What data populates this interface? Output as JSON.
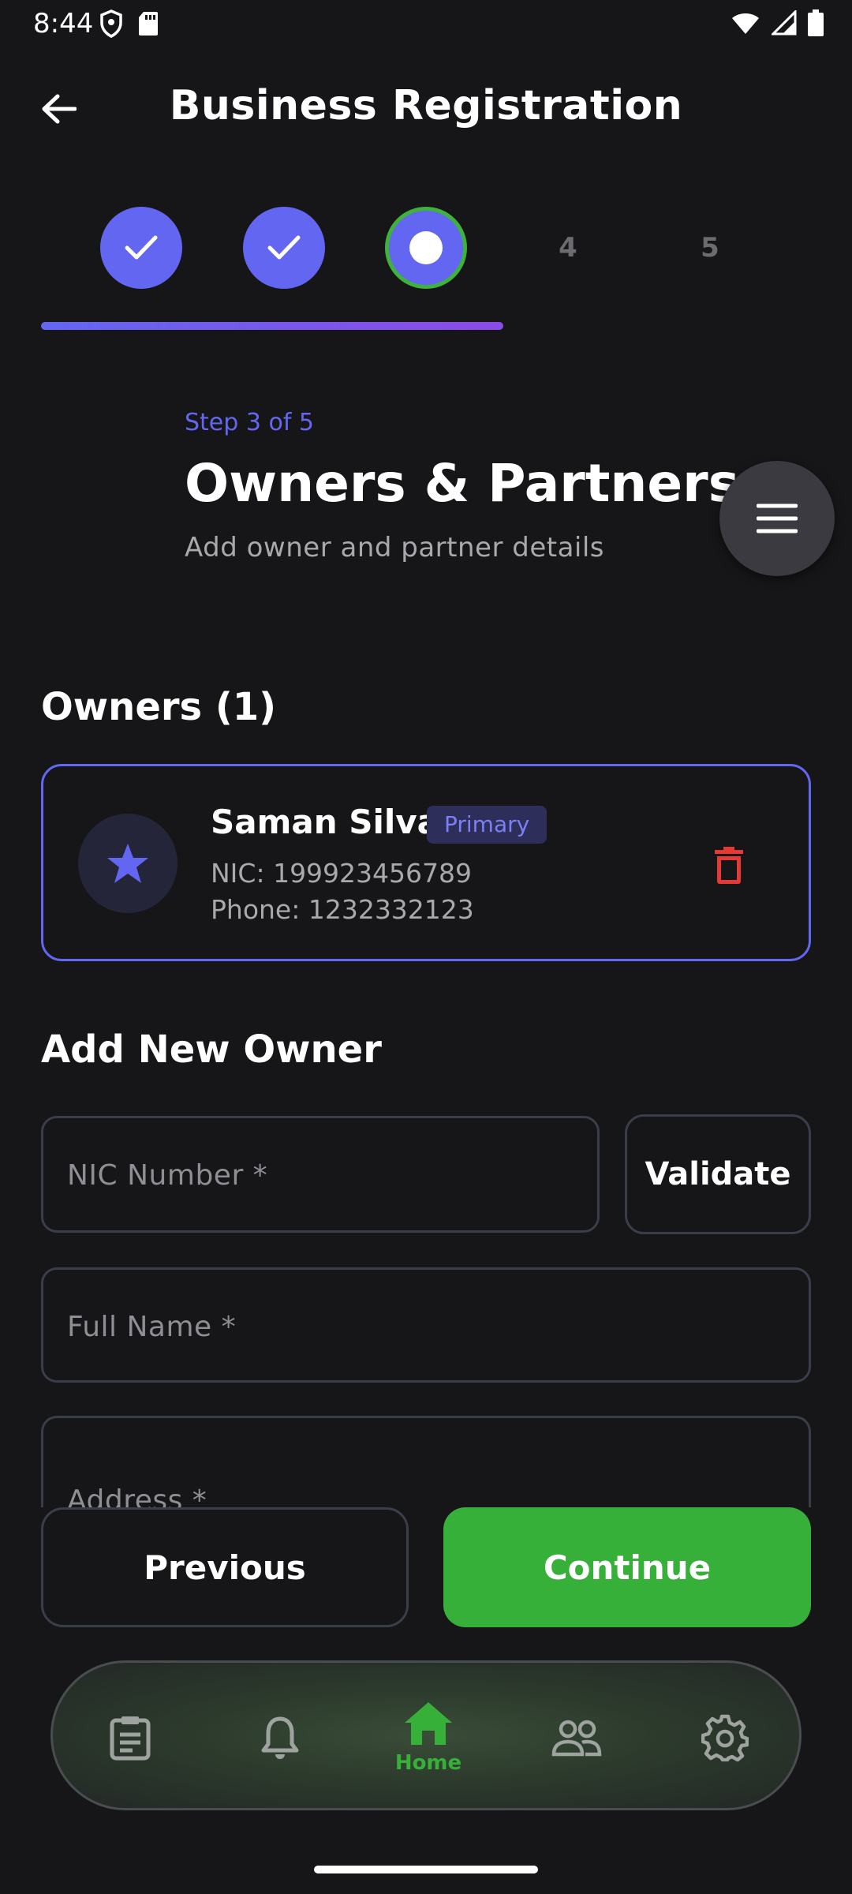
{
  "status_bar": {
    "time": "8:44"
  },
  "app_bar": {
    "title": "Business Registration"
  },
  "stepper": {
    "steps": [
      {
        "number": "1",
        "state": "done"
      },
      {
        "number": "2",
        "state": "done"
      },
      {
        "number": "3",
        "state": "current"
      },
      {
        "number": "4",
        "state": "pending"
      },
      {
        "number": "5",
        "state": "pending"
      }
    ],
    "progress_fraction": 0.6
  },
  "header": {
    "step_caption": "Step 3 of 5",
    "title": "Owners & Partners",
    "subtitle": "Add owner and partner details"
  },
  "owners": {
    "heading": "Owners (1)",
    "items": [
      {
        "name": "Saman Silva",
        "badge": "Primary",
        "nic": "NIC: 199923456789",
        "phone": "Phone: 1232332123"
      }
    ]
  },
  "add_owner": {
    "heading": "Add New Owner",
    "nic_placeholder": "NIC Number *",
    "validate_label": "Validate",
    "name_placeholder": "Full Name *",
    "address_placeholder": "Address *"
  },
  "actions": {
    "previous": "Previous",
    "continue": "Continue"
  },
  "bottom_nav": {
    "items": [
      {
        "icon": "clipboard-icon",
        "label": ""
      },
      {
        "icon": "bell-icon",
        "label": ""
      },
      {
        "icon": "home-icon",
        "label": "Home",
        "active": true
      },
      {
        "icon": "people-icon",
        "label": ""
      },
      {
        "icon": "gear-icon",
        "label": ""
      }
    ]
  },
  "colors": {
    "accent": "#6366f1",
    "success": "#37b03a",
    "danger": "#e53935",
    "background": "#161618"
  }
}
